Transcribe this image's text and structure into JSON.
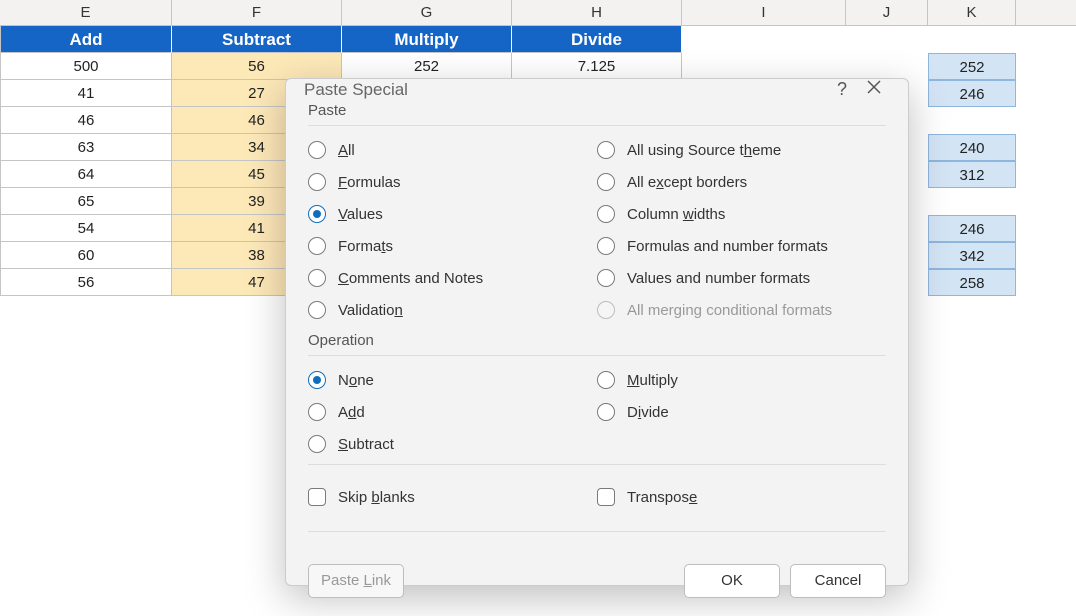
{
  "columns": {
    "E": "E",
    "F": "F",
    "G": "G",
    "H": "H",
    "I": "I",
    "J": "J",
    "K": "K"
  },
  "headers": {
    "E": "Add",
    "F": "Subtract",
    "G": "Multiply",
    "H": "Divide"
  },
  "rows": [
    {
      "E": "500",
      "F": "56",
      "G": "252",
      "H": "7.125"
    },
    {
      "E": "41",
      "F": "27"
    },
    {
      "E": "46",
      "F": "46"
    },
    {
      "E": "63",
      "F": "34"
    },
    {
      "E": "64",
      "F": "45"
    },
    {
      "E": "65",
      "F": "39"
    },
    {
      "E": "54",
      "F": "41"
    },
    {
      "E": "60",
      "F": "38"
    },
    {
      "E": "56",
      "F": "47"
    }
  ],
  "colK": [
    "252",
    "246",
    "",
    "240",
    "312",
    "",
    "246",
    "342",
    "258"
  ],
  "dialog": {
    "title": "Paste Special",
    "help": "?",
    "groups": {
      "paste": "Paste",
      "operation": "Operation"
    },
    "paste_left": [
      {
        "key": "all",
        "label": "All",
        "u": 0
      },
      {
        "key": "formulas",
        "label": "Formulas",
        "u": 0
      },
      {
        "key": "values",
        "label": "Values",
        "u": 0,
        "selected": true
      },
      {
        "key": "formats",
        "label": "Formats",
        "u": 5
      },
      {
        "key": "comments",
        "label": "Comments and Notes",
        "u": 0
      },
      {
        "key": "validation",
        "label": "Validation",
        "u": 9
      }
    ],
    "paste_right": [
      {
        "key": "theme",
        "label": "All using Source theme",
        "u": 18
      },
      {
        "key": "noborders",
        "label": "All except borders",
        "u": 5
      },
      {
        "key": "colwidths",
        "label": "Column widths",
        "u": 7
      },
      {
        "key": "formulanum",
        "label": "Formulas and number formats"
      },
      {
        "key": "valuenum",
        "label": "Values and number formats"
      },
      {
        "key": "mergecond",
        "label": "All merging conditional formats",
        "disabled": true
      }
    ],
    "op_left": [
      {
        "key": "none",
        "label": "None",
        "u": 1,
        "selected": true
      },
      {
        "key": "add",
        "label": "Add",
        "u": 1
      },
      {
        "key": "subtract",
        "label": "Subtract",
        "u": 0
      }
    ],
    "op_right": [
      {
        "key": "multiply",
        "label": "Multiply",
        "u": 0
      },
      {
        "key": "divide",
        "label": "Divide",
        "u": 1
      }
    ],
    "checks": {
      "skip": {
        "label": "Skip blanks",
        "u": 5
      },
      "transpose": {
        "label": "Transpose",
        "u": 8
      }
    },
    "buttons": {
      "pastelink": {
        "label": "Paste Link",
        "u": 6,
        "disabled": true
      },
      "ok": "OK",
      "cancel": "Cancel"
    }
  }
}
